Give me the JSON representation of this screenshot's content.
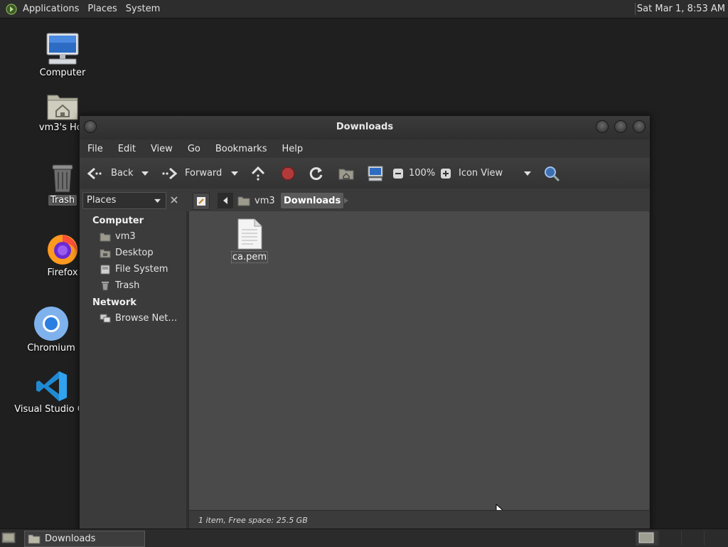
{
  "top_panel": {
    "menus": [
      "Applications",
      "Places",
      "System"
    ],
    "clock": "Sat Mar  1,  8:53 AM"
  },
  "desktop": {
    "icons": [
      {
        "label": "Computer",
        "icon": "computer-icon"
      },
      {
        "label": "vm3's Hor",
        "icon": "home-folder-icon"
      },
      {
        "label": "Trash",
        "icon": "trash-icon"
      },
      {
        "label": "Firefox",
        "icon": "firefox-icon"
      },
      {
        "label": "Chromium",
        "icon": "chromium-icon"
      },
      {
        "label": "Visual Studio Co",
        "icon": "vscode-icon"
      }
    ]
  },
  "window": {
    "title": "Downloads",
    "menus": [
      "File",
      "Edit",
      "View",
      "Go",
      "Bookmarks",
      "Help"
    ],
    "toolbar": {
      "back_label": "Back",
      "forward_label": "Forward",
      "zoom": "100%",
      "view_mode": "Icon View"
    },
    "sidebar": {
      "selector": "Places",
      "sections": [
        {
          "heading": "Computer",
          "items": [
            "vm3",
            "Desktop",
            "File System",
            "Trash"
          ]
        },
        {
          "heading": "Network",
          "items": [
            "Browse Net…"
          ]
        }
      ]
    },
    "path": [
      "vm3",
      "Downloads"
    ],
    "files": [
      {
        "name": "ca.pem",
        "icon": "text-file-icon"
      }
    ],
    "status": "1 item, Free space: 25.5 GB"
  },
  "taskbar": {
    "tasks": [
      {
        "label": "Downloads"
      }
    ]
  },
  "colors": {
    "desktop_bg": "#1f1f1f",
    "panel_bg": "#2d2d2d",
    "window_bg": "#3c3c3c",
    "content_bg": "#4a4a4a"
  }
}
